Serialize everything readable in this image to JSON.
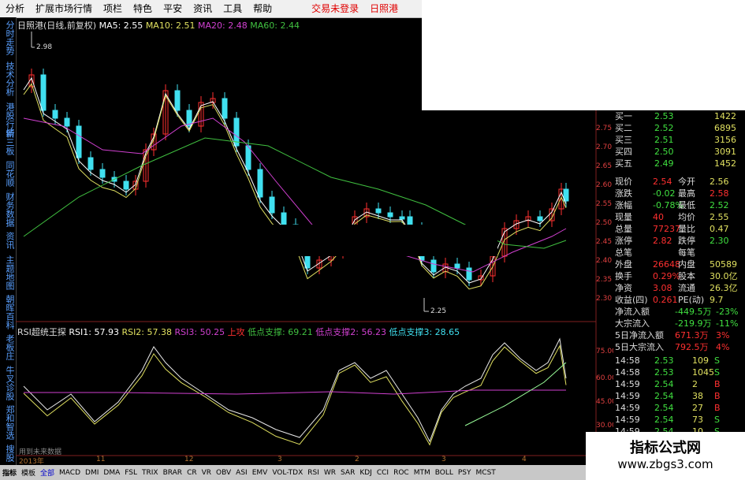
{
  "menu": {
    "items": [
      "分析",
      "扩展市场行情",
      "项栏",
      "特色",
      "平安",
      "资讯",
      "工具",
      "帮助"
    ],
    "right": [
      "交易未登录",
      "日照港"
    ]
  },
  "leftnav": [
    "分时走势",
    "技术分析",
    "港股行情",
    "新三板",
    "同花顺",
    "财务数据",
    "资讯",
    "主题地图",
    "朝晖百科",
    "老板庄",
    "牛叉诊股",
    "郑和智选",
    "搜股"
  ],
  "chart": {
    "title": "日照港(日线,前复权)",
    "ma5": "MA5: 2.55",
    "ma10": "MA10: 2.51",
    "ma20": "MA20: 2.48",
    "ma60": "MA60: 2.44",
    "high": "2.98",
    "low": "2.25",
    "y_ticks": [
      "2.75",
      "2.70",
      "2.65",
      "2.60",
      "2.55",
      "2.50",
      "2.45",
      "2.40",
      "2.35",
      "2.30"
    ]
  },
  "rsi": {
    "title": "RSI超统王探",
    "r1": "RSI1: 57.93",
    "r2": "RSI2: 57.38",
    "r3": "RSI3: 50.25",
    "up": "上攻",
    "s1": "低点支撑: 69.21",
    "s2": "低点支撑2: 56.23",
    "s3": "低点支撑3: 28.65",
    "y_ticks": [
      "75.00",
      "60.00",
      "45.00",
      "30.00"
    ]
  },
  "dates": {
    "d0": "2013年",
    "d1": "11",
    "d2": "12",
    "d3": "3",
    "d4": "2",
    "d5": "3",
    "d6": "4"
  },
  "note": "用到未来数据",
  "quote": {
    "book": [
      {
        "name": "买一",
        "price": "2.53",
        "vol": "1422"
      },
      {
        "name": "买二",
        "price": "2.52",
        "vol": "6895"
      },
      {
        "name": "买三",
        "price": "2.51",
        "vol": "3156"
      },
      {
        "name": "买四",
        "price": "2.50",
        "vol": "3091"
      },
      {
        "name": "买五",
        "price": "2.49",
        "vol": "1452"
      }
    ],
    "stats": [
      [
        "现价",
        "2.54",
        "今开",
        "2.56"
      ],
      [
        "涨跌",
        "-0.02",
        "最高",
        "2.58"
      ],
      [
        "涨幅",
        "-0.78%",
        "最低",
        "2.52"
      ],
      [
        "现量",
        "40",
        "均价",
        "2.55"
      ],
      [
        "总量",
        "77237",
        "量比",
        "0.47"
      ],
      [
        "涨停",
        "2.82",
        "跌停",
        "2.30"
      ],
      [
        "总笔",
        "",
        "每笔",
        ""
      ],
      [
        "外盘",
        "26648",
        "内盘",
        "50589"
      ],
      [
        "换手",
        "0.29%",
        "股本",
        "30.0亿"
      ],
      [
        "净资",
        "3.08",
        "流通",
        "26.3亿"
      ],
      [
        "收益(四)",
        "0.261",
        "PE(动)",
        "9.7"
      ]
    ],
    "flow": [
      [
        "净流入额",
        "-449.5万",
        "-23%"
      ],
      [
        "大宗流入",
        "-219.9万",
        "-11%"
      ],
      [
        "5日净流入额",
        "671.3万",
        "3%"
      ],
      [
        "5日大宗流入",
        "792.5万",
        "4%"
      ]
    ],
    "ticks": [
      [
        "14:58",
        "2.53",
        "109",
        "S"
      ],
      [
        "14:58",
        "2.53",
        "1045",
        "S"
      ],
      [
        "14:59",
        "2.54",
        "2",
        "B"
      ],
      [
        "14:59",
        "2.54",
        "38",
        "B"
      ],
      [
        "14:59",
        "2.54",
        "27",
        "B"
      ],
      [
        "14:59",
        "2.54",
        "73",
        "S"
      ],
      [
        "14:59",
        "2.54",
        "10",
        "S"
      ]
    ]
  },
  "bottom_tabs": [
    "指标",
    "模板",
    "全部",
    "MACD",
    "DMI",
    "DMA",
    "FSL",
    "TRIX",
    "BRAR",
    "CR",
    "VR",
    "OBV",
    "ASI",
    "EMV",
    "VOL-TDX",
    "RSI",
    "WR",
    "SAR",
    "KDJ",
    "CCI",
    "ROC",
    "MTM",
    "BOLL",
    "PSY",
    "MCST"
  ],
  "watermark": {
    "title": "指标公式网",
    "url": "www.zbgs3.com"
  },
  "colors": {
    "up": "#ff3030",
    "down": "#40e0f0",
    "ma5": "#ffffff",
    "ma10": "#e0e060",
    "ma20": "#d040d0",
    "ma60": "#40c040"
  }
}
